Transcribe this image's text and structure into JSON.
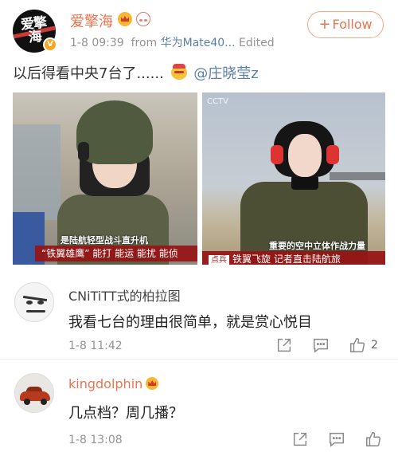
{
  "post": {
    "username": "爱擎海",
    "meta_date": "1-8 09:39",
    "meta_from": "from",
    "meta_device": "华为Mate40...",
    "meta_edited": "Edited",
    "follow_label": "Follow",
    "text_prefix": "以后得看中央7台了......",
    "mention": "@庄晓莹z",
    "avatar_text": "爱擎海"
  },
  "photos": [
    {
      "subtitle_top": "是陆航轻型战斗直升机",
      "subtitle_band": "“铁翼雄鹰” 能打 能运 能扰 能侦"
    },
    {
      "channel_logo": "CCTV",
      "subtitle_top": "重要的空中立体作战力量",
      "subtitle_chip": "点兵",
      "subtitle_band": "铁翼飞旋 记者直击陆航旅"
    }
  ],
  "comments": [
    {
      "name": "CNiTiTT式的柏拉图",
      "text": "我看七台的理由很简单，就是赏心悦目",
      "time": "1-8 11:42",
      "likes": "2"
    },
    {
      "name": "kingdolphin",
      "text": "几点档？周几播？",
      "time": "1-8 13:08",
      "likes": ""
    }
  ],
  "icons": {
    "share": "share-icon",
    "comment": "comment-icon",
    "like": "thumbs-up-icon"
  },
  "colors": {
    "accent": "#eb7350",
    "link": "#5d7fa8",
    "meta": "#939393"
  }
}
